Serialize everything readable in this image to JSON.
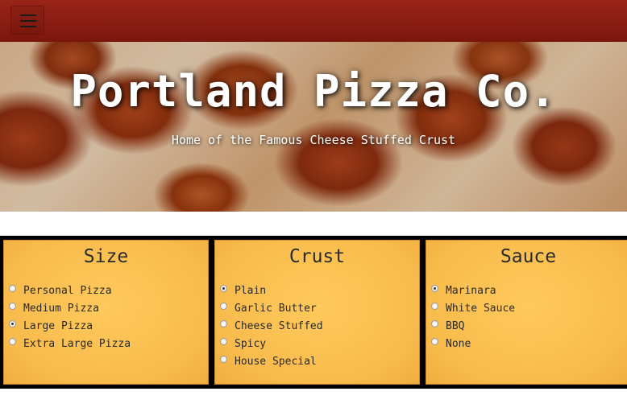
{
  "navbar": {
    "menu_icon": "hamburger-menu-icon",
    "bg_color": "#8a1d12"
  },
  "hero": {
    "title": "Portland Pizza Co.",
    "subtitle": "Home of the Famous Cheese Stuffed Crust"
  },
  "options": {
    "panel_color": "#f8bb4c",
    "size": {
      "heading": "Size",
      "items": [
        {
          "label": "Personal Pizza",
          "selected": false
        },
        {
          "label": "Medium Pizza",
          "selected": false
        },
        {
          "label": "Large Pizza",
          "selected": true
        },
        {
          "label": "Extra Large Pizza",
          "selected": false
        }
      ]
    },
    "crust": {
      "heading": "Crust",
      "items": [
        {
          "label": "Plain",
          "selected": true
        },
        {
          "label": "Garlic Butter",
          "selected": false
        },
        {
          "label": "Cheese Stuffed",
          "selected": false
        },
        {
          "label": "Spicy",
          "selected": false
        },
        {
          "label": "House Special",
          "selected": false
        }
      ]
    },
    "sauce": {
      "heading": "Sauce",
      "items": [
        {
          "label": "Marinara",
          "selected": true
        },
        {
          "label": "White Sauce",
          "selected": false
        },
        {
          "label": "BBQ",
          "selected": false
        },
        {
          "label": "None",
          "selected": false
        }
      ]
    }
  }
}
